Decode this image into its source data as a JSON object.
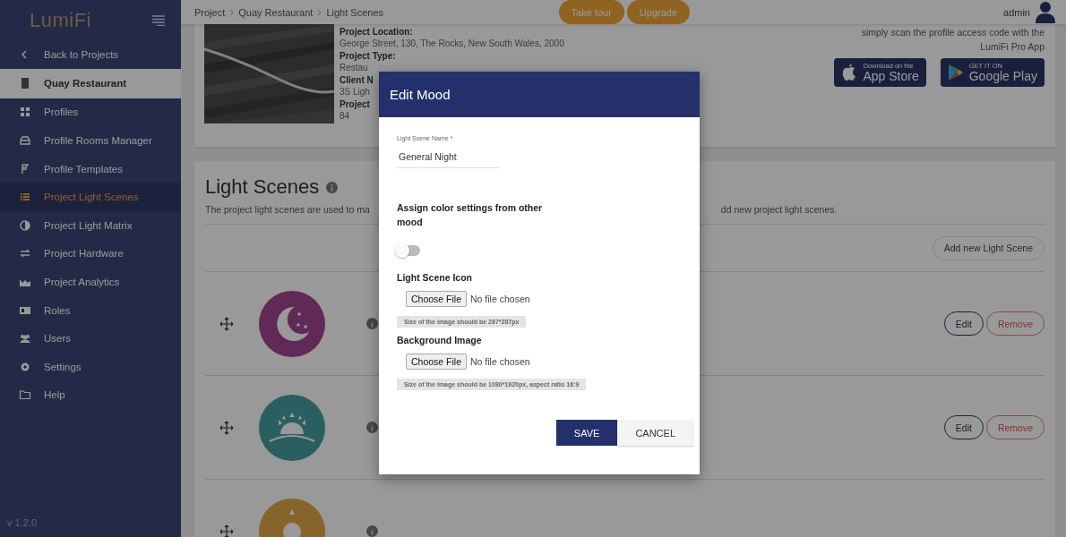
{
  "sidebar": {
    "logo": "LumiFi",
    "version": "v 1.2.0",
    "items": [
      {
        "label": "Back to Projects",
        "kind": "back",
        "selected": false
      },
      {
        "label": "Quay Restaurant",
        "kind": "project",
        "selected": false
      },
      {
        "label": "Profiles",
        "kind": "item",
        "selected": false
      },
      {
        "label": "Profile Rooms Manager",
        "kind": "item",
        "selected": false
      },
      {
        "label": "Profile Templates",
        "kind": "item",
        "selected": false
      },
      {
        "label": "Project Light Scenes",
        "kind": "item",
        "selected": true
      },
      {
        "label": "Project Light Matrix",
        "kind": "item",
        "selected": false
      },
      {
        "label": "Project Hardware",
        "kind": "item",
        "selected": false
      },
      {
        "label": "Project Analytics",
        "kind": "item",
        "selected": false
      },
      {
        "label": "Roles",
        "kind": "item",
        "selected": false
      },
      {
        "label": "Users",
        "kind": "item",
        "selected": false
      },
      {
        "label": "Settings",
        "kind": "item",
        "selected": false
      },
      {
        "label": "Help",
        "kind": "item",
        "selected": false
      }
    ]
  },
  "topbar": {
    "breadcrumbs": [
      "Project",
      "Quay Restaurant",
      "Light Scenes"
    ],
    "buttons": [
      "Take tour",
      "Upgrade"
    ],
    "user": "admin"
  },
  "project_card": {
    "info": [
      {
        "text": "Project Location:",
        "kind": "label"
      },
      {
        "text": "George Street, 130, The Rocks, New South Wales, 2000",
        "kind": "value"
      },
      {
        "text": "Project Type:",
        "kind": "label"
      },
      {
        "text": "Restau",
        "kind": "value"
      },
      {
        "text": "Client N",
        "kind": "label"
      },
      {
        "text": "3S Ligh",
        "kind": "value"
      },
      {
        "text": "Project",
        "kind": "label"
      },
      {
        "text": "84",
        "kind": "value"
      }
    ],
    "app_note": "simply scan the profile access code with the LumiFi Pro App",
    "stores": [
      {
        "kind": "apple",
        "small": "Download on the",
        "big": "App Store"
      },
      {
        "kind": "google",
        "small": "GET IT ON",
        "big": "Google Play"
      }
    ]
  },
  "light_scenes": {
    "title": "Light Scenes",
    "description_start": "The project light scenes are used to ma",
    "description_end": "dd new project light scenes.",
    "add_button": "Add new Light Scene",
    "rows": [
      {
        "color": "#612a56",
        "edit": "Edit",
        "remove": "Remove"
      },
      {
        "color": "#2a5f61",
        "edit": "Edit",
        "remove": "Remove"
      },
      {
        "color": "#876429"
      }
    ]
  },
  "dialog": {
    "title": "Edit Mood",
    "name_label": "Light Scene Name *",
    "name_value": "General Night",
    "assign_label": "Assign color settings from other mood",
    "assign_on": false,
    "uploads": [
      {
        "label": "Light Scene Icon",
        "button": "Choose File",
        "status": "No file chosen",
        "hint": "Size of the image should be 287*287px"
      },
      {
        "label": "Background Image",
        "button": "Choose File",
        "status": "No file chosen",
        "hint": "Size of the image should be 1080*1920px, aspect ratio 16:9"
      }
    ],
    "buttons": [
      {
        "label": "SAVE",
        "kind": "primary"
      },
      {
        "label": "CANCEL",
        "kind": "secondary"
      }
    ]
  }
}
